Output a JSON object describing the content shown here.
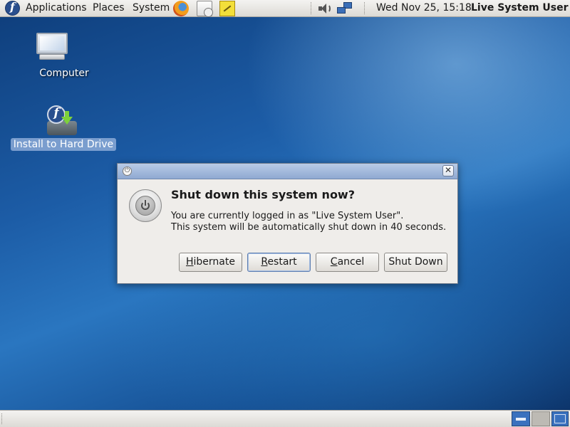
{
  "top_panel": {
    "menus": {
      "applications": "Applications",
      "places": "Places",
      "system": "System"
    },
    "launchers": [
      "firefox-icon",
      "mail-clock-icon",
      "notes-icon"
    ],
    "tray_icons": [
      "volume-icon",
      "network-icon"
    ],
    "clock": "Wed Nov 25, 15:18",
    "user": "Live System User"
  },
  "desktop": {
    "icons": [
      {
        "label": "Computer",
        "icon": "computer-icon",
        "selected": false
      },
      {
        "label": "Install to Hard Drive",
        "icon": "install-icon",
        "selected": true
      }
    ]
  },
  "dialog": {
    "heading": "Shut down this system now?",
    "message_line1": "You are currently logged in as \"Live System User\".",
    "message_line2": "This system will be automatically shut down in 40 seconds.",
    "buttons": {
      "hibernate": {
        "mnemonic": "H",
        "rest": "ibernate"
      },
      "restart": {
        "mnemonic": "R",
        "rest": "estart"
      },
      "cancel": {
        "mnemonic": "C",
        "rest": "ancel"
      },
      "shut_down": {
        "mnemonic": "",
        "rest": "Shut Down"
      }
    },
    "focused_button": "restart"
  },
  "colors": {
    "panel": "#dcdad5",
    "dialog_title_bar": "#8fa9d2",
    "desktop_blue": "#1c5ca6",
    "selection": "#8caad7"
  }
}
